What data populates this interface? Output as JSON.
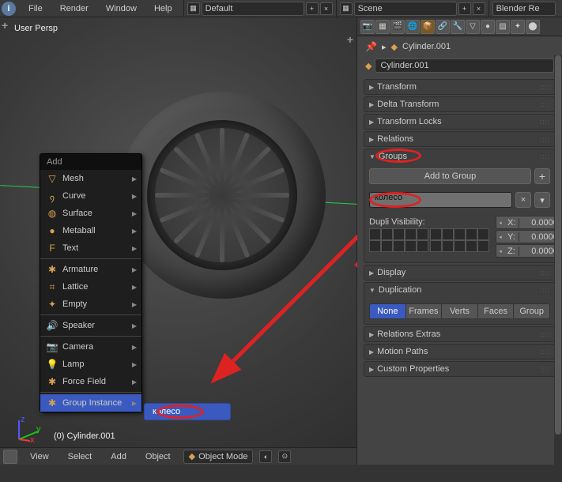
{
  "top_menu": {
    "file": "File",
    "render": "Render",
    "window": "Window",
    "help": "Help",
    "layout": "Default",
    "scene": "Scene",
    "renderer": "Blender Re"
  },
  "viewport": {
    "view_label": "User Persp",
    "object_label": "(0) Cylinder.001"
  },
  "footer": {
    "view": "View",
    "select": "Select",
    "add": "Add",
    "object": "Object",
    "mode": "Object Mode"
  },
  "add_menu": {
    "title": "Add",
    "items": [
      "Mesh",
      "Curve",
      "Surface",
      "Metaball",
      "Text",
      "Armature",
      "Lattice",
      "Empty",
      "Speaker",
      "Camera",
      "Lamp",
      "Force Field",
      "Group Instance"
    ],
    "submenu": "колесо"
  },
  "properties": {
    "breadcrumb": "Cylinder.001",
    "name": "Cylinder.001",
    "sections": {
      "transform": "Transform",
      "delta": "Delta Transform",
      "locks": "Transform Locks",
      "relations": "Relations",
      "groups": "Groups",
      "display": "Display",
      "duplication": "Duplication",
      "rel_extras": "Relations Extras",
      "motion": "Motion Paths",
      "custom": "Custom Properties"
    },
    "add_to_group": "Add to Group",
    "group_name": "колесо",
    "dupli_visibility": "Dupli Visibility:",
    "xyz": {
      "x": "0.00000",
      "y": "0.00000",
      "z": "0.00000"
    },
    "dupli_tabs": {
      "none": "None",
      "frames": "Frames",
      "verts": "Verts",
      "faces": "Faces",
      "group": "Group"
    }
  }
}
